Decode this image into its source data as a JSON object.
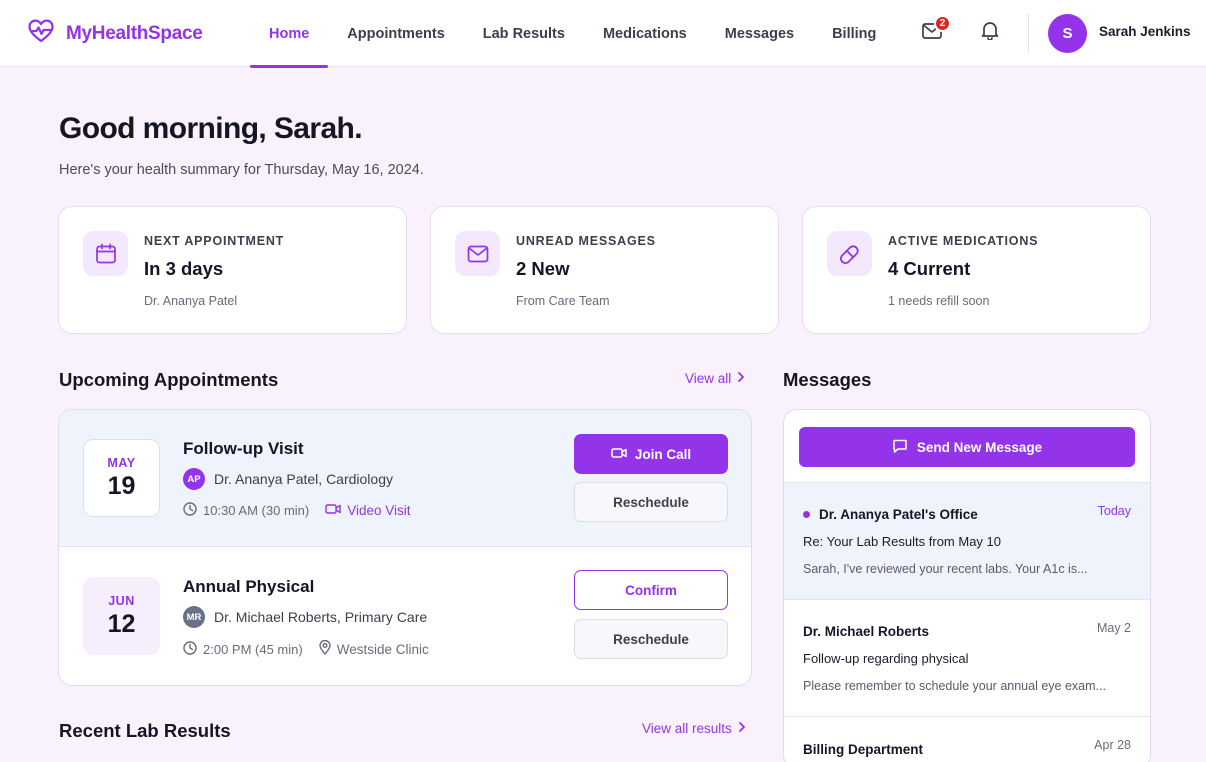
{
  "app": {
    "name": "MyHealthSpace",
    "brand_color": "#9333ea"
  },
  "nav": {
    "items": [
      {
        "label": "Home",
        "active": true
      },
      {
        "label": "Appointments"
      },
      {
        "label": "Lab Results"
      },
      {
        "label": "Medications"
      },
      {
        "label": "Messages"
      },
      {
        "label": "Billing"
      }
    ]
  },
  "header": {
    "mail_badge": "2",
    "user_initial": "S",
    "user_name": "Sarah Jenkins",
    "icons": [
      "mail-icon",
      "bell-icon"
    ]
  },
  "greeting": {
    "title": "Good morning, Sarah.",
    "subtitle": "Here's your health summary for Thursday, May 16, 2024."
  },
  "stats": [
    {
      "icon": "calendar-icon",
      "label": "NEXT APPOINTMENT",
      "value": "In 3 days",
      "sub": "Dr. Ananya Patel"
    },
    {
      "icon": "mail-icon",
      "label": "UNREAD MESSAGES",
      "value": "2 New",
      "sub": "From Care Team"
    },
    {
      "icon": "pill-icon",
      "label": "ACTIVE MEDICATIONS",
      "value": "4 Current",
      "sub": "1 needs refill soon"
    }
  ],
  "appointments": {
    "title": "Upcoming Appointments",
    "view_all": "View all",
    "items": [
      {
        "month": "MAY",
        "day": "19",
        "title": "Follow-up Visit",
        "doctor_initials": "AP",
        "doctor": "Dr. Ananya Patel, Cardiology",
        "time": "10:30 AM (30 min)",
        "location": "Video Visit",
        "primary_action": "Join Call",
        "secondary_action": "Reschedule"
      },
      {
        "month": "JUN",
        "day": "12",
        "title": "Annual Physical",
        "doctor_initials": "MR",
        "doctor": "Dr. Michael Roberts, Primary Care",
        "time": "2:00 PM (45 min)",
        "location": "Westside Clinic",
        "primary_action": "Confirm",
        "secondary_action": "Reschedule"
      }
    ]
  },
  "messages": {
    "title": "Messages",
    "send_label": "Send New Message",
    "items": [
      {
        "from": "Dr. Ananya Patel's Office",
        "date": "Today",
        "subject": "Re: Your Lab Results from May 10",
        "preview": "Sarah, I've reviewed your recent labs. Your A1c is...",
        "unread": true
      },
      {
        "from": "Dr. Michael Roberts",
        "date": "May 2",
        "subject": "Follow-up regarding physical",
        "preview": "Please remember to schedule your annual eye exam...",
        "unread": false
      },
      {
        "from": "Billing Department",
        "date": "Apr 28",
        "subject": "",
        "preview": "",
        "unread": false
      }
    ]
  },
  "lab_results": {
    "title": "Recent Lab Results",
    "view_all": "View all results"
  }
}
